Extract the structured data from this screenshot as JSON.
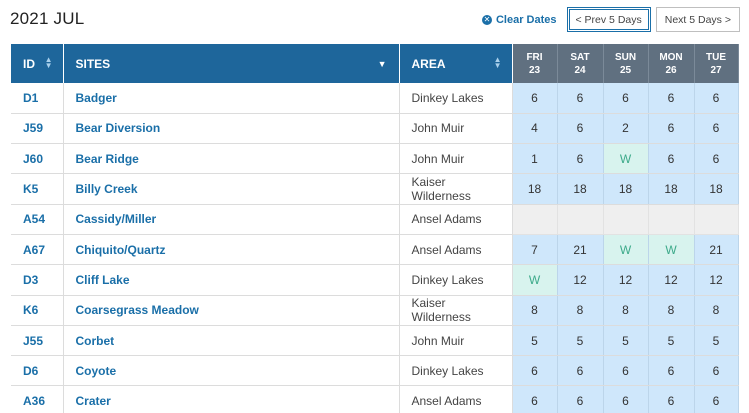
{
  "header": {
    "title": "2021 JUL",
    "clear_label": "Clear Dates",
    "prev_label": "< Prev 5 Days",
    "next_label": "Next 5 Days >"
  },
  "columns": {
    "id": "ID",
    "sites": "SITES",
    "area": "AREA",
    "days": [
      {
        "dow": "FRI",
        "date": "23"
      },
      {
        "dow": "SAT",
        "date": "24"
      },
      {
        "dow": "SUN",
        "date": "25"
      },
      {
        "dow": "MON",
        "date": "26"
      },
      {
        "dow": "TUE",
        "date": "27"
      }
    ]
  },
  "rows": [
    {
      "id": "D1",
      "site": "Badger",
      "area": "Dinkey Lakes",
      "days": [
        "6",
        "6",
        "6",
        "6",
        "6"
      ]
    },
    {
      "id": "J59",
      "site": "Bear Diversion",
      "area": "John Muir",
      "days": [
        "4",
        "6",
        "2",
        "6",
        "6"
      ]
    },
    {
      "id": "J60",
      "site": "Bear Ridge",
      "area": "John Muir",
      "days": [
        "1",
        "6",
        "W",
        "6",
        "6"
      ]
    },
    {
      "id": "K5",
      "site": "Billy Creek",
      "area": "Kaiser Wilderness",
      "days": [
        "18",
        "18",
        "18",
        "18",
        "18"
      ]
    },
    {
      "id": "A54",
      "site": "Cassidy/Miller",
      "area": "Ansel Adams",
      "days": [
        "",
        "",
        "",
        "",
        ""
      ]
    },
    {
      "id": "A67",
      "site": "Chiquito/Quartz",
      "area": "Ansel Adams",
      "days": [
        "7",
        "21",
        "W",
        "W",
        "21"
      ]
    },
    {
      "id": "D3",
      "site": "Cliff Lake",
      "area": "Dinkey Lakes",
      "days": [
        "W",
        "12",
        "12",
        "12",
        "12"
      ]
    },
    {
      "id": "K6",
      "site": "Coarsegrass Meadow",
      "area": "Kaiser Wilderness",
      "days": [
        "8",
        "8",
        "8",
        "8",
        "8"
      ]
    },
    {
      "id": "J55",
      "site": "Corbet",
      "area": "John Muir",
      "days": [
        "5",
        "5",
        "5",
        "5",
        "5"
      ]
    },
    {
      "id": "D6",
      "site": "Coyote",
      "area": "Dinkey Lakes",
      "days": [
        "6",
        "6",
        "6",
        "6",
        "6"
      ]
    },
    {
      "id": "A36",
      "site": "Crater",
      "area": "Ansel Adams",
      "days": [
        "6",
        "6",
        "6",
        "6",
        "6"
      ]
    }
  ],
  "colors": {
    "header_bg": "#1e669b",
    "day_header_bg": "#607080",
    "available_bg": "#cfe7fb",
    "walkin_bg": "#d8f3ee",
    "unavailable_bg": "#efefef",
    "link": "#1a6fa8"
  }
}
